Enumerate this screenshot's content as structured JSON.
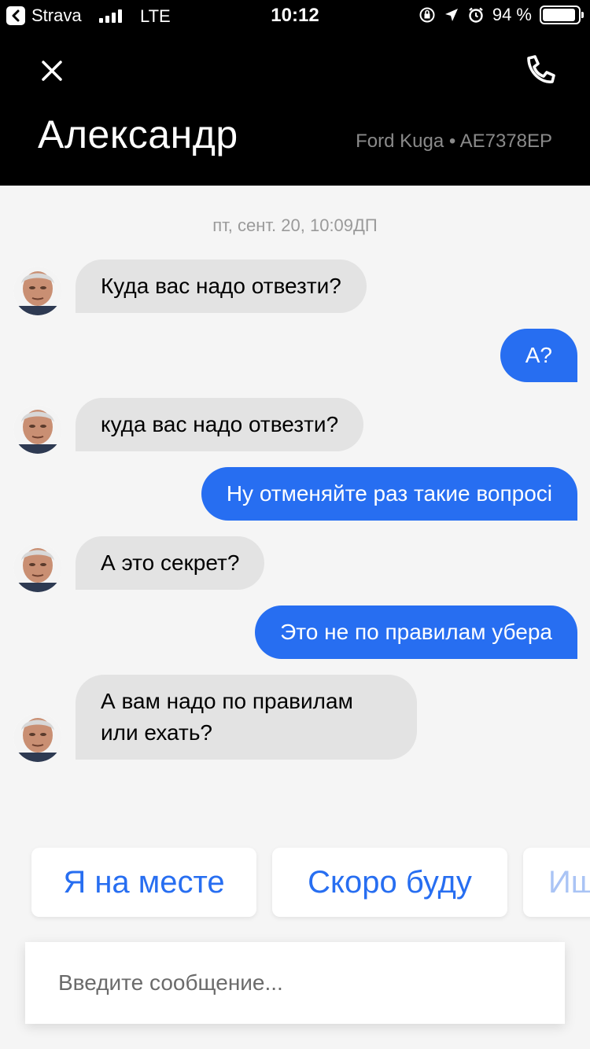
{
  "status_bar": {
    "back_app": "Strava",
    "network": "LTE",
    "time": "10:12",
    "battery": "94 %",
    "battery_level": 0.94
  },
  "header": {
    "driver_name": "Александр",
    "car": "Ford Kuga • AE7378EP"
  },
  "chat": {
    "timestamp": "пт, сент. 20, 10:09ДП",
    "messages": [
      {
        "from": "driver",
        "text": "Куда вас надо отвезти?"
      },
      {
        "from": "me",
        "text": "А?"
      },
      {
        "from": "driver",
        "text": "куда вас надо отвезти?"
      },
      {
        "from": "me",
        "text": "Ну отменяйте раз такие вопросі"
      },
      {
        "from": "driver",
        "text": "А это секрет?"
      },
      {
        "from": "me",
        "text": "Это не по правилам убера"
      },
      {
        "from": "driver",
        "text": "А вам надо по правилам или ехать?"
      }
    ]
  },
  "quick_replies": [
    "Я на месте",
    "Скоро буду",
    "Ищ"
  ],
  "composer": {
    "placeholder": "Введите сообщение..."
  },
  "colors": {
    "accent": "#276ef1",
    "incoming_bubble": "#e3e3e3",
    "header_bg": "#000000",
    "background": "#f5f5f5"
  }
}
